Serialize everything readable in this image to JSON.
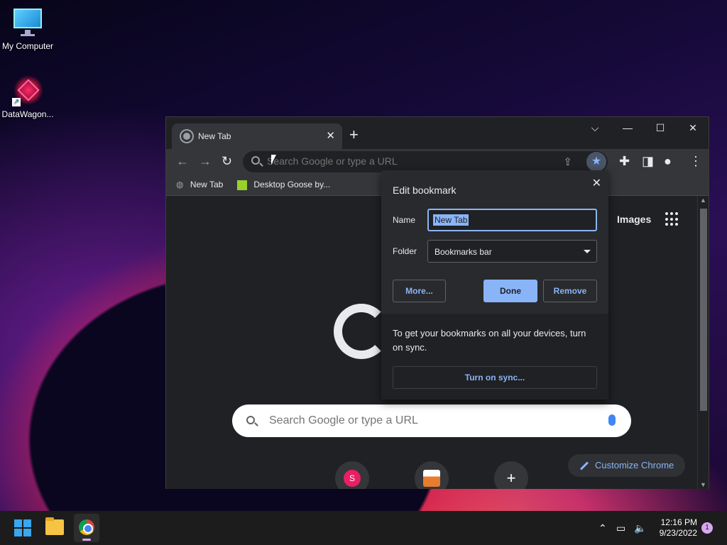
{
  "desktop": {
    "icons": [
      {
        "label": "My Computer"
      },
      {
        "label": "DataWagon..."
      }
    ]
  },
  "browser": {
    "tab": {
      "title": "New Tab"
    },
    "window_controls": {
      "dropdown": "⌵",
      "minimize": "—",
      "maximize": "☐",
      "close": "✕"
    },
    "omnibox": {
      "placeholder": "Search Google or type a URL"
    },
    "bookmarks": [
      {
        "label": "New Tab"
      },
      {
        "label": "Desktop Goose by..."
      }
    ],
    "ntp": {
      "images_link": "Images",
      "search_placeholder": "Search Google or type a URL",
      "customize_label": "Customize Chrome",
      "shortcuts": [
        {
          "initial": "S",
          "color": "#e91e63"
        },
        {
          "initial": "",
          "color": "#e67c2e"
        },
        {
          "initial": "+",
          "color": "#35363a"
        }
      ]
    }
  },
  "bookmark_bubble": {
    "title": "Edit bookmark",
    "name_label": "Name",
    "name_value": "New Tab",
    "folder_label": "Folder",
    "folder_value": "Bookmarks bar",
    "more_button": "More...",
    "done_button": "Done",
    "remove_button": "Remove",
    "sync_text": "To get your bookmarks on all your devices, turn on sync.",
    "sync_button": "Turn on sync..."
  },
  "taskbar": {
    "time": "12:16 PM",
    "date": "9/23/2022",
    "notification_count": "1"
  },
  "colors": {
    "accent": "#8ab4f8",
    "dark_bg": "#202124",
    "toolbar": "#35363a"
  }
}
